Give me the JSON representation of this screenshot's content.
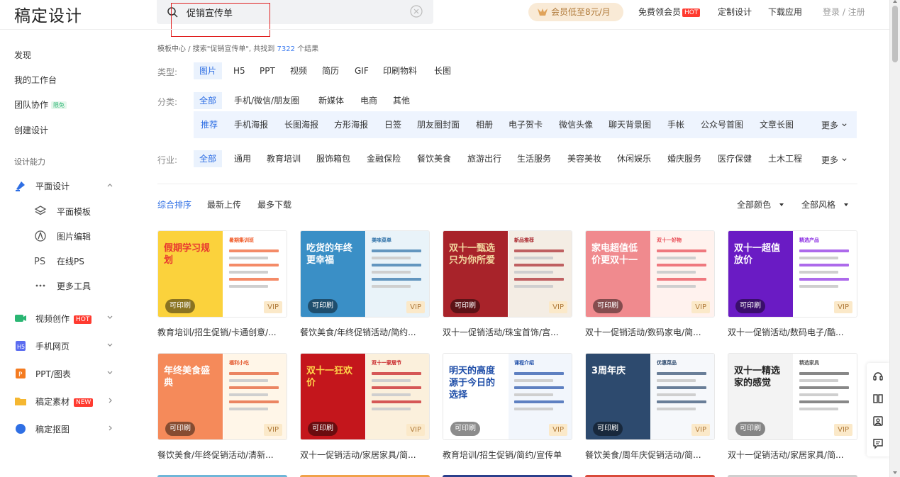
{
  "header": {
    "logo": "稿定设计",
    "search_value": "促销宣传单",
    "vip_pill": "会员低至8元/月",
    "nav": [
      "免费领会员",
      "定制设计",
      "下载应用"
    ],
    "hot_badge": "HOT",
    "login": "登录 / 注册"
  },
  "sidebar": {
    "top_items": [
      "发现",
      "我的工作台",
      "团队协作",
      "创建设计"
    ],
    "free_badge": "限免",
    "section_title": "设计能力",
    "design": {
      "label": "平面设计",
      "subs": [
        "平面模板",
        "图片编辑",
        "在线PS",
        "更多工具"
      ]
    },
    "groups": [
      {
        "label": "视频创作",
        "badge": "HOT"
      },
      {
        "label": "手机网页",
        "badge": ""
      },
      {
        "label": "PPT/图表",
        "badge": ""
      },
      {
        "label": "稿定素材",
        "badge": "NEW"
      },
      {
        "label": "稿定抠图",
        "badge": ""
      }
    ]
  },
  "breadcrumb": {
    "part1": "模板中心",
    "sep": " / ",
    "part2": "搜索\"促销宣传单\", 共找到",
    "count": "7322",
    "part3": "个结果"
  },
  "filters": {
    "type_label": "类型:",
    "types": [
      "图片",
      "H5",
      "PPT",
      "视频",
      "简历",
      "GIF",
      "印刷物料",
      "长图"
    ],
    "category_label": "分类:",
    "categories": [
      "全部",
      "手机/微信/朋友圈",
      "新媒体",
      "电商",
      "其他"
    ],
    "subcategories": [
      "推荐",
      "手机海报",
      "长图海报",
      "方形海报",
      "日签",
      "朋友圈封面",
      "相册",
      "电子贺卡",
      "微信头像",
      "聊天背景图",
      "手帐",
      "公众号首图",
      "文章长图"
    ],
    "industry_label": "行业:",
    "industries": [
      "全部",
      "通用",
      "教育培训",
      "服饰箱包",
      "金融保险",
      "餐饮美食",
      "旅游出行",
      "生活服务",
      "美容美妆",
      "休闲娱乐",
      "婚庆服务",
      "医疗保健",
      "土木工程"
    ],
    "more": "更多"
  },
  "sort": {
    "options": [
      "综合排序",
      "最新上传",
      "最多下载"
    ],
    "color_filter": "全部颜色",
    "style_filter": "全部风格"
  },
  "cards": {
    "printable": "可印刷",
    "vip": "VIP",
    "items": [
      {
        "caption": "教育培训/招生促销/卡通创意/...",
        "headline": "假期学习规划",
        "right": "暑期集训班",
        "cl": "#fbd23c",
        "cr": "#ffffff",
        "ht": "#e8382f",
        "accent": "#f05a28"
      },
      {
        "caption": "餐饮美食/年终促销活动/简约...",
        "headline": "吃货的年终更幸福",
        "right": "美味菜单",
        "cl": "#3a8fc6",
        "cr": "#e9f3f9",
        "ht": "#ffffff",
        "accent": "#2a6ea6"
      },
      {
        "caption": "双十一促销活动/珠宝首饰/宫...",
        "headline": "双十一甄选只为你所爱",
        "right": "新品推荐",
        "cl": "#a8232a",
        "cr": "#f4ede4",
        "ht": "#f3d9a0",
        "accent": "#a8232a"
      },
      {
        "caption": "双十一促销活动/数码家电/简...",
        "headline": "家电超值低价更双十一",
        "right": "双十一好物",
        "cl": "#f08a8e",
        "cr": "#fff2ee",
        "ht": "#ffffff",
        "accent": "#e8454f"
      },
      {
        "caption": "双十一促销活动/数码电子/酷...",
        "headline": "双十一超值放价",
        "right": "精选产品",
        "cl": "#6a1bc4",
        "cr": "#ffffff",
        "ht": "#ffffff",
        "accent": "#8a2be2"
      },
      {
        "caption": "餐饮美食/年终促销活动/清新...",
        "headline": "年终美食盛典",
        "right": "福利小吃",
        "cl": "#f58a5a",
        "cr": "#fff6e8",
        "ht": "#ffffff",
        "accent": "#e3552a"
      },
      {
        "caption": "双十一促销活动/家居家具/简...",
        "headline": "双十一狂欢价",
        "right": "双十一家居节",
        "cl": "#c4161c",
        "cr": "#fbf0dc",
        "ht": "#ffd54a",
        "accent": "#c4161c"
      },
      {
        "caption": "教育培训/招生促销/简约/宣传单",
        "headline": "明天的高度源于今日的选择",
        "right": "课程介绍",
        "cl": "#ffffff",
        "cr": "#f2f6fc",
        "ht": "#1f4ea8",
        "accent": "#1f4ea8"
      },
      {
        "caption": "餐饮美食/周年庆促销活动/简...",
        "headline": "3周年庆",
        "right": "优惠菜品",
        "cl": "#2d4a6e",
        "cr": "#f6f8fb",
        "ht": "#ffffff",
        "accent": "#2d4a6e"
      },
      {
        "caption": "双十一促销活动/家居家具/简...",
        "headline": "双十一精选家的感觉",
        "right": "精选家具",
        "cl": "#f3f3f3",
        "cr": "#ffffff",
        "ht": "#222222",
        "accent": "#555555"
      }
    ]
  },
  "colors": {
    "accent": "#2f6fe4",
    "active_chip_bg": "#eaf2fd",
    "hot_red": "#ff3b30"
  }
}
